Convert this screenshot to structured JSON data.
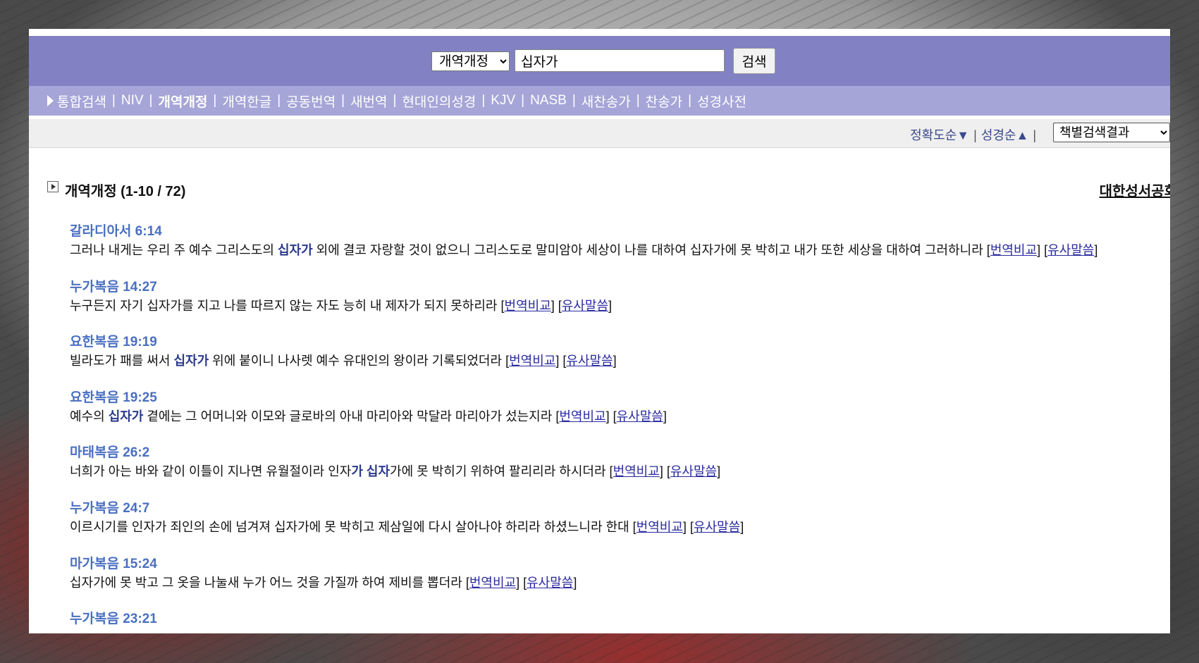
{
  "search": {
    "version_selected": "개역개정",
    "query": "십자가",
    "button_label": "검색"
  },
  "nav": {
    "items": [
      "통합검색",
      "NIV",
      "개역개정",
      "개역한글",
      "공동번역",
      "새번역",
      "현대인의성경",
      "KJV",
      "NASB",
      "새찬송가",
      "찬송가",
      "성경사전"
    ],
    "active": "개역개정",
    "separator": "|"
  },
  "sort": {
    "accuracy_label": "정확도순▼",
    "bible_order_label": "성경순▲",
    "separator": "|",
    "group_selected": "책별검색결과"
  },
  "results": {
    "title": "개역개정 (1-10 / 72)",
    "publisher": "대한성서공회",
    "compare_label": "번역비교",
    "similar_label": "유사말씀",
    "verses": [
      {
        "ref": "갈라디아서 6:14",
        "pre": "그러나 내게는 우리 주 예수 그리스도의 ",
        "hl": "십자가",
        "post": " 외에 결코 자랑할 것이 없으니 그리스도로 말미암아 세상이 나를 대하여 십자가에 못 박히고 내가 또한 세상을 대하여 그러하니라 "
      },
      {
        "ref": "누가복음 14:27",
        "pre": "누구든지 자기 십자가를 지고 나를 따르지 않는 자도 능히 내 제자가 되지 못하리라 ",
        "hl": "",
        "post": ""
      },
      {
        "ref": "요한복음 19:19",
        "pre": "빌라도가 패를 써서 ",
        "hl": "십자가",
        "post": " 위에 붙이니 나사렛 예수 유대인의 왕이라 기록되었더라 "
      },
      {
        "ref": "요한복음 19:25",
        "pre": "예수의 ",
        "hl": "십자가",
        "post": " 곁에는 그 어머니와 이모와 글로바의 아내 마리아와 막달라 마리아가 섰는지라 "
      },
      {
        "ref": "마태복음 26:2",
        "pre": "너희가 아는 바와 같이 이틀이 지나면 유월절이라 인자",
        "hl": "가 십자",
        "post": "가에 못 박히기 위하여 팔리리라 하시더라 "
      },
      {
        "ref": "누가복음 24:7",
        "pre": "이르시기를 인자가 죄인의 손에 넘겨져 십자가에 못 박히고 제삼일에 다시 살아나야 하리라 하셨느니라 한대 ",
        "hl": "",
        "post": ""
      },
      {
        "ref": "마가복음 15:24",
        "pre": "십자가에 못 박고 그 옷을 나눌새 누가 어느 것을 가질까 하여 제비를 뽑더라 ",
        "hl": "",
        "post": ""
      },
      {
        "ref": "누가복음 23:21",
        "pre": "",
        "hl": "",
        "post": ""
      }
    ]
  },
  "colors": {
    "search_bar": "#8181c4",
    "nav_bar": "#a5a5d8",
    "ref_link": "#4a6fc1",
    "highlight": "#2a3a8a"
  }
}
